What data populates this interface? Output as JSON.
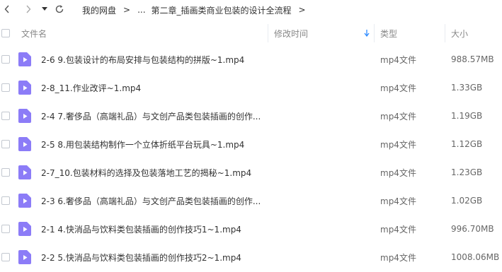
{
  "breadcrumb": {
    "root": "我的网盘",
    "sep": ">",
    "ellipsis": "...",
    "current": "第二章_插画类商业包装的设计全流程"
  },
  "columns": {
    "name": "文件名",
    "modified": "修改时间",
    "type": "类型",
    "size": "大小"
  },
  "sort": {
    "column": "修改时间",
    "direction": "descending"
  },
  "colors": {
    "accent": "#2f8cff",
    "file_icon": "#8c7cf7"
  },
  "files": [
    {
      "name": "2-6 9.包装设计的布局安排与包装结构的拼版~1.mp4",
      "type": "mp4文件",
      "size": "988.57MB"
    },
    {
      "name": "2-8_11.作业改评~1.mp4",
      "type": "mp4文件",
      "size": "1.33GB"
    },
    {
      "name": "2-4 7.奢侈品（高端礼品）与文创产品类包装插画的创作...",
      "type": "mp4文件",
      "size": "1.19GB"
    },
    {
      "name": "2-5 8.用包装结构制作一个立体折纸平台玩具~1.mp4",
      "type": "mp4文件",
      "size": "1.12GB"
    },
    {
      "name": "2-7_10.包装材料的选择及包装落地工艺的揭秘~1.mp4",
      "type": "mp4文件",
      "size": "1.23GB"
    },
    {
      "name": "2-3 6.奢侈品（高端礼品）与文创产品类包装插画的创作...",
      "type": "mp4文件",
      "size": "1.02GB"
    },
    {
      "name": "2-1 4.快消品与饮料类包装插画的创作技巧1~1.mp4",
      "type": "mp4文件",
      "size": "996.70MB"
    },
    {
      "name": "2-2 5.快消品与饮料类包装插画的创作技巧2~1.mp4",
      "type": "mp4文件",
      "size": "1008.06MB"
    }
  ]
}
